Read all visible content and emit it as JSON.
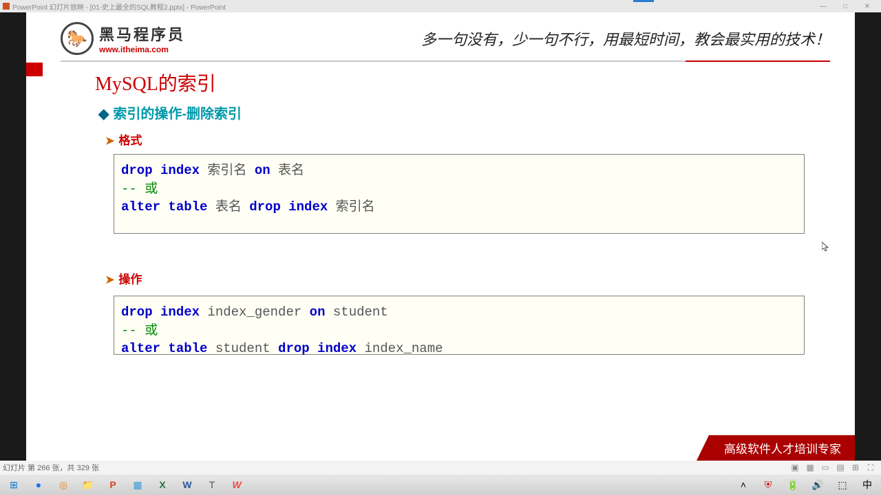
{
  "window": {
    "title": "PowerPoint 幻灯片放映 - [01-史上最全的SQL教程2.pptx] - PowerPoint"
  },
  "logo": {
    "cn": "黑马程序员",
    "url": "www.itheima.com",
    "slogan": "多一句没有，少一句不行，用最短时间，教会最实用的技术！"
  },
  "slide": {
    "title": "MySQL的索引",
    "subtitle": "索引的操作-删除索引",
    "section1_label": "格式",
    "section2_label": "操作"
  },
  "code1": {
    "l1_kw1": "drop index",
    "l1_t1": " 索引名 ",
    "l1_kw2": "on",
    "l1_t2": " 表名",
    "l2": "-- 或",
    "l3_kw1": "alter table",
    "l3_t1": " 表名 ",
    "l3_kw2": "drop index",
    "l3_t2": " 索引名"
  },
  "code2": {
    "l1_kw1": "drop index",
    "l1_t1": " index_gender ",
    "l1_kw2": "on",
    "l1_t2": " student",
    "l2": "-- 或",
    "l3_kw1": "alter table",
    "l3_t1": " student ",
    "l3_kw2": "drop index",
    "l3_t2": " index_name"
  },
  "footer": {
    "banner": "高级软件人才培训专家"
  },
  "status": {
    "text": "幻灯片 第 266 张，共 329 张"
  },
  "taskbar": {
    "items": [
      "⊞",
      "🌐",
      "◎",
      "📁",
      "P",
      "▦",
      "X",
      "W",
      "T",
      "W"
    ]
  }
}
